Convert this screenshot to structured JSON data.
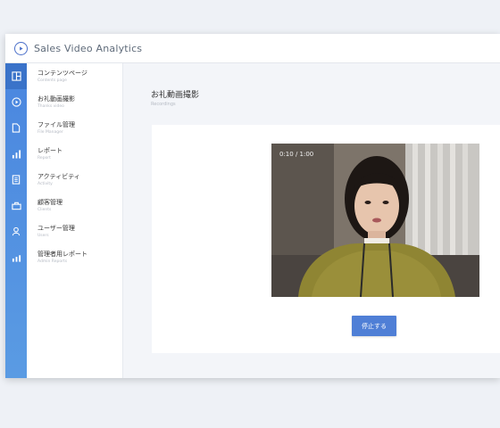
{
  "app": {
    "title": "Sales Video Analytics"
  },
  "sidebar": {
    "icons": [
      "dashboard-icon",
      "play-icon",
      "document-icon",
      "bar-chart-icon",
      "list-icon",
      "briefcase-icon",
      "user-icon",
      "report-icon"
    ],
    "items": [
      {
        "label": "コンテンツページ",
        "sub": "Contents page"
      },
      {
        "label": "お礼動画撮影",
        "sub": "Thanks video"
      },
      {
        "label": "ファイル管理",
        "sub": "File Manager"
      },
      {
        "label": "レポート",
        "sub": "Report"
      },
      {
        "label": "アクティビティ",
        "sub": "Activity"
      },
      {
        "label": "顧客管理",
        "sub": "Clients"
      },
      {
        "label": "ユーザー管理",
        "sub": "Users"
      },
      {
        "label": "管理者用レポート",
        "sub": "Admin Reports"
      }
    ]
  },
  "main": {
    "title": "お礼動画撮影",
    "subtitle": "Recordings",
    "video": {
      "timer": "0:10 / 1:00"
    },
    "stop_button": "停止する"
  },
  "colors": {
    "accent": "#4f7fd6",
    "sidebar": "#4a86df"
  }
}
